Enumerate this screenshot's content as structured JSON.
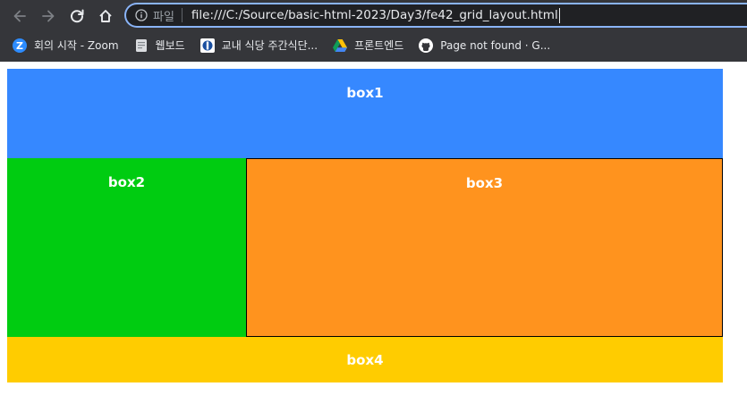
{
  "browser": {
    "omnibox": {
      "scheme_label": "파일",
      "url": "file:///C:/Source/basic-html-2023/Day3/fe42_grid_layout.html"
    },
    "icons": {
      "back": "back-arrow-icon",
      "forward": "forward-arrow-icon",
      "reload": "reload-icon",
      "home": "home-icon",
      "info": "info-icon"
    },
    "bookmarks": [
      {
        "label": "회의 시작 - Zoom",
        "icon": "zoom-icon"
      },
      {
        "label": "웹보드",
        "icon": "notepad-icon"
      },
      {
        "label": "교내 식당 주간식단...",
        "icon": "school-icon"
      },
      {
        "label": "프론트엔드",
        "icon": "google-drive-icon"
      },
      {
        "label": "Page not found · G...",
        "icon": "github-icon"
      }
    ]
  },
  "grid": {
    "boxes": [
      {
        "label": "box1",
        "color": "#3688ff"
      },
      {
        "label": "box2",
        "color": "#00cc11"
      },
      {
        "label": "box3",
        "color": "#ff931e"
      },
      {
        "label": "box4",
        "color": "#ffcc00"
      }
    ]
  }
}
